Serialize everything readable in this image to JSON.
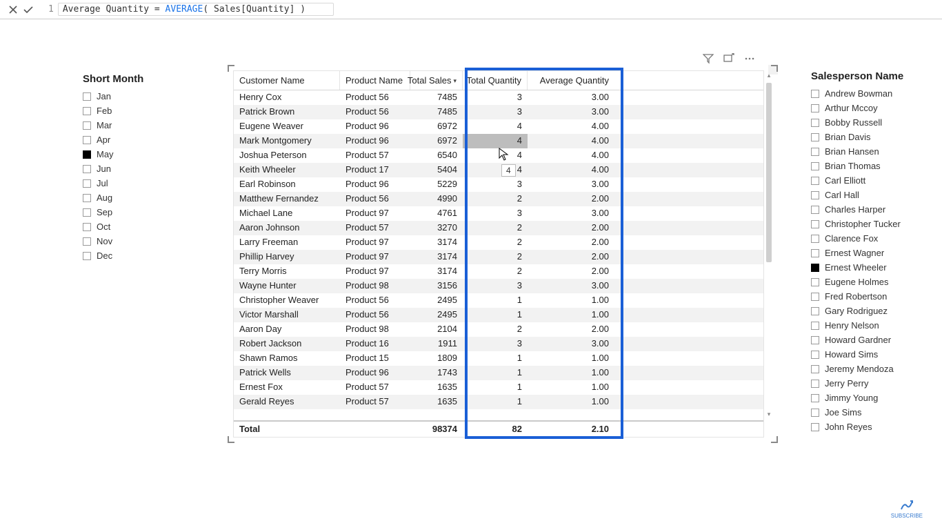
{
  "formula_bar": {
    "line_no": "1",
    "measure_name": "Average Quantity",
    "equals": " = ",
    "func": "AVERAGE",
    "open": "(",
    "arg": " Sales[Quantity] ",
    "close": ")"
  },
  "toolbar": {
    "filter_label": "Filter",
    "focus_label": "Focus mode",
    "more_label": "More options"
  },
  "slicer_month": {
    "title": "Short Month",
    "items": [
      {
        "label": "Jan",
        "selected": false
      },
      {
        "label": "Feb",
        "selected": false
      },
      {
        "label": "Mar",
        "selected": false
      },
      {
        "label": "Apr",
        "selected": false
      },
      {
        "label": "May",
        "selected": true
      },
      {
        "label": "Jun",
        "selected": false
      },
      {
        "label": "Jul",
        "selected": false
      },
      {
        "label": "Aug",
        "selected": false
      },
      {
        "label": "Sep",
        "selected": false
      },
      {
        "label": "Oct",
        "selected": false
      },
      {
        "label": "Nov",
        "selected": false
      },
      {
        "label": "Dec",
        "selected": false
      }
    ]
  },
  "slicer_salesperson": {
    "title": "Salesperson Name",
    "items": [
      {
        "label": "Andrew Bowman",
        "selected": false
      },
      {
        "label": "Arthur Mccoy",
        "selected": false
      },
      {
        "label": "Bobby Russell",
        "selected": false
      },
      {
        "label": "Brian Davis",
        "selected": false
      },
      {
        "label": "Brian Hansen",
        "selected": false
      },
      {
        "label": "Brian Thomas",
        "selected": false
      },
      {
        "label": "Carl Elliott",
        "selected": false
      },
      {
        "label": "Carl Hall",
        "selected": false
      },
      {
        "label": "Charles Harper",
        "selected": false
      },
      {
        "label": "Christopher Tucker",
        "selected": false
      },
      {
        "label": "Clarence Fox",
        "selected": false
      },
      {
        "label": "Ernest Wagner",
        "selected": false
      },
      {
        "label": "Ernest Wheeler",
        "selected": true
      },
      {
        "label": "Eugene Holmes",
        "selected": false
      },
      {
        "label": "Fred Robertson",
        "selected": false
      },
      {
        "label": "Gary Rodriguez",
        "selected": false
      },
      {
        "label": "Henry Nelson",
        "selected": false
      },
      {
        "label": "Howard Gardner",
        "selected": false
      },
      {
        "label": "Howard Sims",
        "selected": false
      },
      {
        "label": "Jeremy Mendoza",
        "selected": false
      },
      {
        "label": "Jerry Perry",
        "selected": false
      },
      {
        "label": "Jimmy Young",
        "selected": false
      },
      {
        "label": "Joe Sims",
        "selected": false
      },
      {
        "label": "John Reyes",
        "selected": false
      }
    ]
  },
  "table": {
    "columns": {
      "customer": "Customer Name",
      "product": "Product Name",
      "sales": "Total Sales",
      "qty": "Total Quantity",
      "avg": "Average Quantity"
    },
    "rows": [
      {
        "customer": "Henry Cox",
        "product": "Product 56",
        "sales": "7485",
        "qty": "3",
        "avg": "3.00"
      },
      {
        "customer": "Patrick Brown",
        "product": "Product 56",
        "sales": "7485",
        "qty": "3",
        "avg": "3.00"
      },
      {
        "customer": "Eugene Weaver",
        "product": "Product 96",
        "sales": "6972",
        "qty": "4",
        "avg": "4.00"
      },
      {
        "customer": "Mark Montgomery",
        "product": "Product 96",
        "sales": "6972",
        "qty": "4",
        "avg": "4.00"
      },
      {
        "customer": "Joshua Peterson",
        "product": "Product 57",
        "sales": "6540",
        "qty": "4",
        "avg": "4.00"
      },
      {
        "customer": "Keith Wheeler",
        "product": "Product 17",
        "sales": "5404",
        "qty": "4",
        "avg": "4.00"
      },
      {
        "customer": "Earl Robinson",
        "product": "Product 96",
        "sales": "5229",
        "qty": "3",
        "avg": "3.00"
      },
      {
        "customer": "Matthew Fernandez",
        "product": "Product 56",
        "sales": "4990",
        "qty": "2",
        "avg": "2.00"
      },
      {
        "customer": "Michael Lane",
        "product": "Product 97",
        "sales": "4761",
        "qty": "3",
        "avg": "3.00"
      },
      {
        "customer": "Aaron Johnson",
        "product": "Product 57",
        "sales": "3270",
        "qty": "2",
        "avg": "2.00"
      },
      {
        "customer": "Larry Freeman",
        "product": "Product 97",
        "sales": "3174",
        "qty": "2",
        "avg": "2.00"
      },
      {
        "customer": "Phillip Harvey",
        "product": "Product 97",
        "sales": "3174",
        "qty": "2",
        "avg": "2.00"
      },
      {
        "customer": "Terry Morris",
        "product": "Product 97",
        "sales": "3174",
        "qty": "2",
        "avg": "2.00"
      },
      {
        "customer": "Wayne Hunter",
        "product": "Product 98",
        "sales": "3156",
        "qty": "3",
        "avg": "3.00"
      },
      {
        "customer": "Christopher Weaver",
        "product": "Product 56",
        "sales": "2495",
        "qty": "1",
        "avg": "1.00"
      },
      {
        "customer": "Victor Marshall",
        "product": "Product 56",
        "sales": "2495",
        "qty": "1",
        "avg": "1.00"
      },
      {
        "customer": "Aaron Day",
        "product": "Product 98",
        "sales": "2104",
        "qty": "2",
        "avg": "2.00"
      },
      {
        "customer": "Robert Jackson",
        "product": "Product 16",
        "sales": "1911",
        "qty": "3",
        "avg": "3.00"
      },
      {
        "customer": "Shawn Ramos",
        "product": "Product 15",
        "sales": "1809",
        "qty": "1",
        "avg": "1.00"
      },
      {
        "customer": "Patrick Wells",
        "product": "Product 96",
        "sales": "1743",
        "qty": "1",
        "avg": "1.00"
      },
      {
        "customer": "Ernest Fox",
        "product": "Product 57",
        "sales": "1635",
        "qty": "1",
        "avg": "1.00"
      },
      {
        "customer": "Gerald Reyes",
        "product": "Product 57",
        "sales": "1635",
        "qty": "1",
        "avg": "1.00"
      }
    ],
    "total": {
      "label": "Total",
      "sales": "98374",
      "qty": "82",
      "avg": "2.10"
    }
  },
  "tooltip_value": "4",
  "subscribe_label": "SUBSCRIBE"
}
